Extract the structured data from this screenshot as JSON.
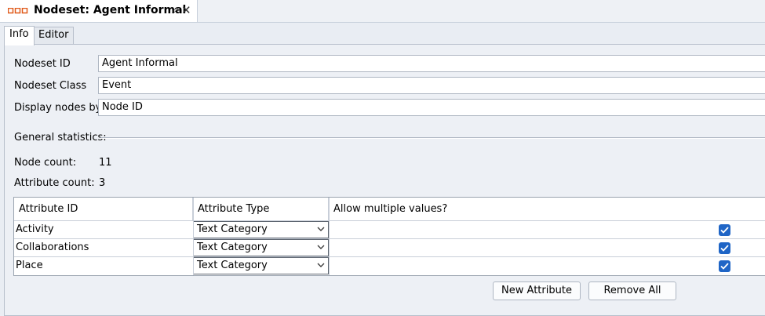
{
  "document_tab": {
    "title": "Nodeset: Agent Informal",
    "icon": "nodeset-icon",
    "pin_icon": "pin-icon",
    "close_icon": "close-icon"
  },
  "subtabs": [
    {
      "label": "Info",
      "active": true
    },
    {
      "label": "Editor",
      "active": false
    }
  ],
  "fields": {
    "nodeset_id": {
      "label": "Nodeset ID",
      "value": "Agent Informal"
    },
    "nodeset_class": {
      "label": "Nodeset Class",
      "value": "Event"
    },
    "display_nodes_by": {
      "label": "Display nodes by",
      "value": "Node ID"
    }
  },
  "statistics": {
    "heading": "General statistics:",
    "node_count_label": "Node count:",
    "node_count": "11",
    "attribute_count_label": "Attribute count:",
    "attribute_count": "3"
  },
  "table": {
    "headers": [
      "Attribute ID",
      "Attribute Type",
      "Allow multiple values?"
    ],
    "rows": [
      {
        "id": "Activity",
        "type": "Text Category",
        "multiple": true
      },
      {
        "id": "Collaborations",
        "type": "Text Category",
        "multiple": true
      },
      {
        "id": "Place",
        "type": "Text Category",
        "multiple": true
      }
    ]
  },
  "buttons": {
    "new_attribute": "New Attribute",
    "remove_all": "Remove All"
  },
  "colors": {
    "accent": "#1f65c6",
    "icon_orange": "#e05a1a"
  }
}
